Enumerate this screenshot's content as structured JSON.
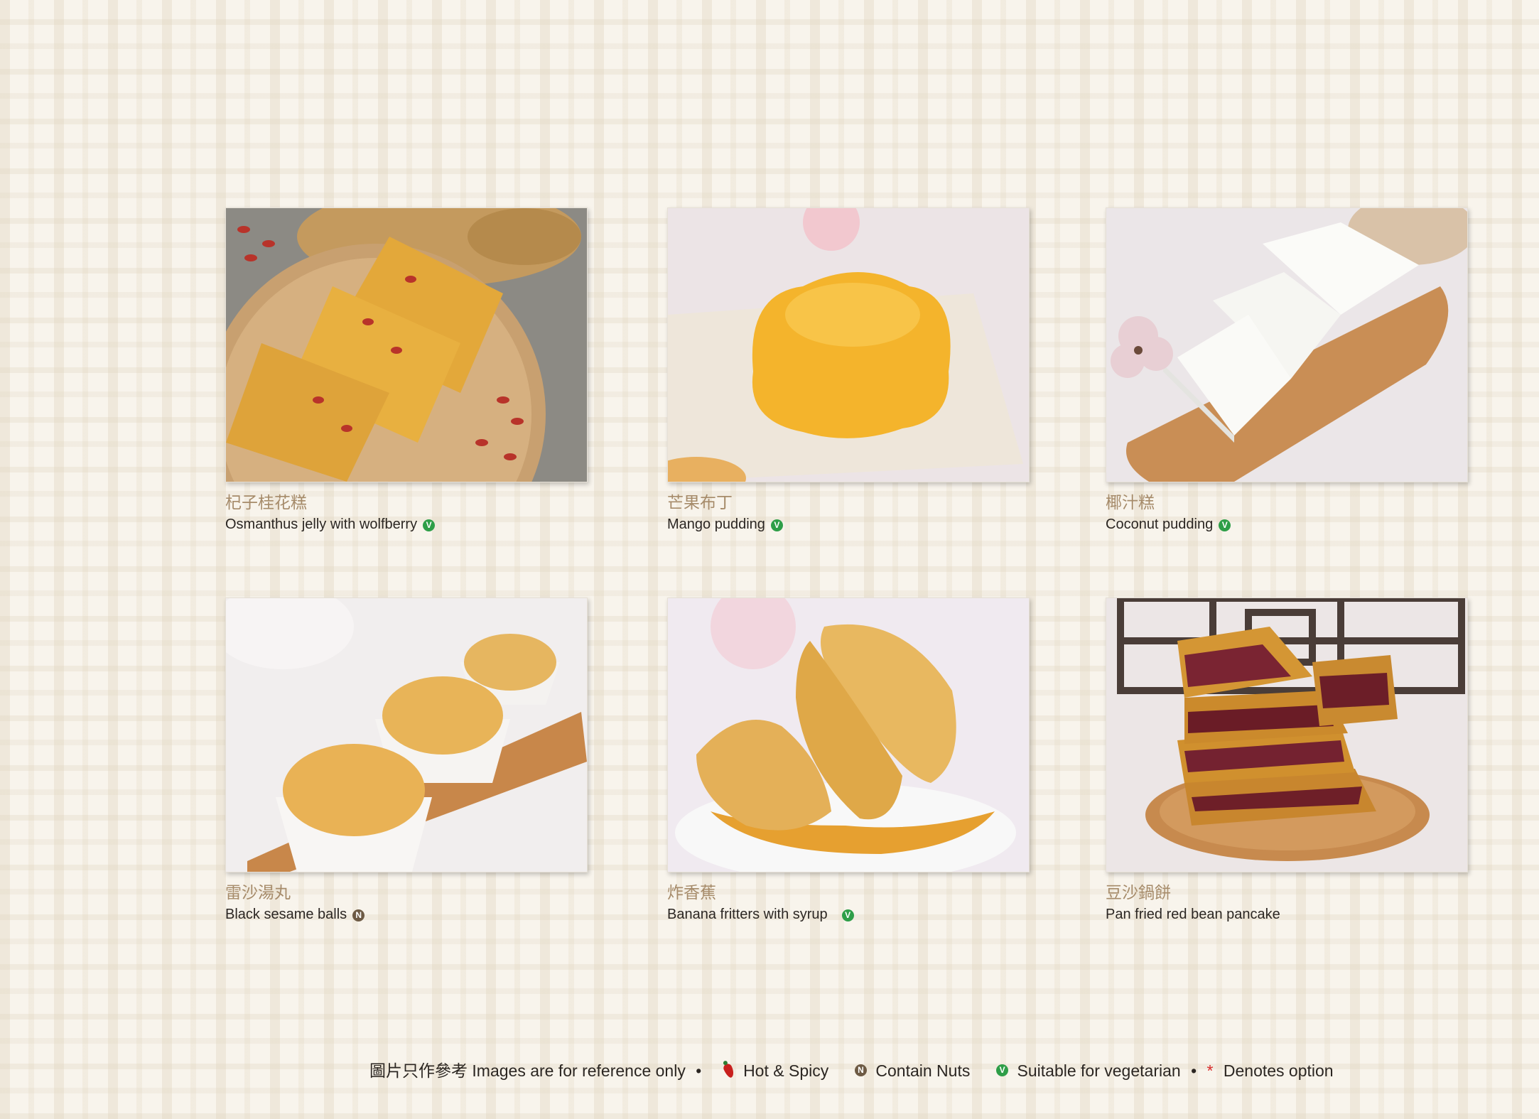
{
  "items": [
    {
      "cn": "杞子桂花糕",
      "en": "Osmanthus jelly with wolfberry",
      "badge": "V"
    },
    {
      "cn": "芒果布丁",
      "en": "Mango pudding",
      "badge": "V"
    },
    {
      "cn": "椰汁糕",
      "en": "Coconut pudding",
      "badge": "V"
    },
    {
      "cn": "雷沙湯丸",
      "en": "Black sesame balls",
      "badge": "N"
    },
    {
      "cn": "炸香蕉",
      "en": "Banana fritters with syrup",
      "badge": "V"
    },
    {
      "cn": "豆沙鍋餅",
      "en": "Pan fried red bean pancake",
      "badge": ""
    }
  ],
  "footer": {
    "reference": "圖片只作參考 Images are for reference only",
    "bullet": "•",
    "hot_spicy": "Hot & Spicy",
    "contain_nuts": "Contain Nuts",
    "vegetarian": "Suitable for vegetarian",
    "asterisk": "*",
    "option": "Denotes option",
    "badge_n": "N",
    "badge_v": "V"
  },
  "colors": {
    "vegetarian_badge": "#2e9e48",
    "nuts_badge": "#6d5a44",
    "chinese_text": "#a68b6a",
    "spicy": "#c8201e"
  }
}
